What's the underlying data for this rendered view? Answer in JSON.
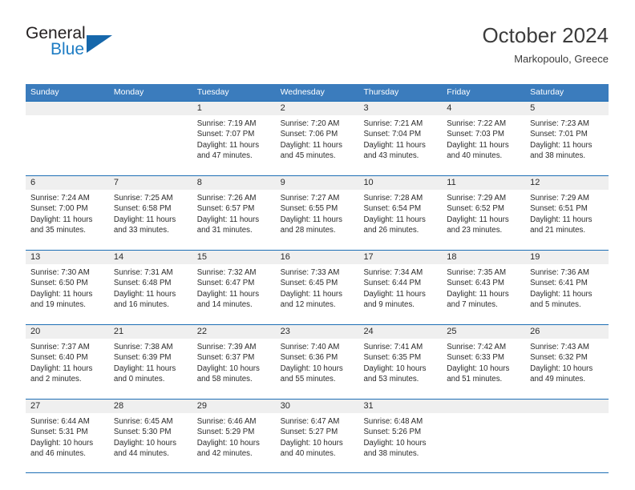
{
  "brand": {
    "name_top": "General",
    "name_bottom": "Blue",
    "triangle_icon": "blue-triangle-icon",
    "color_dark": "#231f20",
    "color_blue": "#1d7cc4"
  },
  "header": {
    "title": "October 2024",
    "subtitle": "Markopoulo, Greece"
  },
  "colors": {
    "header_bar": "#3b7cbd",
    "row_divider": "#1e6fb5",
    "date_band": "#efefef"
  },
  "weekdays": [
    "Sunday",
    "Monday",
    "Tuesday",
    "Wednesday",
    "Thursday",
    "Friday",
    "Saturday"
  ],
  "weeks": [
    [
      {
        "day": "",
        "lines": []
      },
      {
        "day": "",
        "lines": []
      },
      {
        "day": "1",
        "lines": [
          "Sunrise: 7:19 AM",
          "Sunset: 7:07 PM",
          "Daylight: 11 hours",
          "and 47 minutes."
        ]
      },
      {
        "day": "2",
        "lines": [
          "Sunrise: 7:20 AM",
          "Sunset: 7:06 PM",
          "Daylight: 11 hours",
          "and 45 minutes."
        ]
      },
      {
        "day": "3",
        "lines": [
          "Sunrise: 7:21 AM",
          "Sunset: 7:04 PM",
          "Daylight: 11 hours",
          "and 43 minutes."
        ]
      },
      {
        "day": "4",
        "lines": [
          "Sunrise: 7:22 AM",
          "Sunset: 7:03 PM",
          "Daylight: 11 hours",
          "and 40 minutes."
        ]
      },
      {
        "day": "5",
        "lines": [
          "Sunrise: 7:23 AM",
          "Sunset: 7:01 PM",
          "Daylight: 11 hours",
          "and 38 minutes."
        ]
      }
    ],
    [
      {
        "day": "6",
        "lines": [
          "Sunrise: 7:24 AM",
          "Sunset: 7:00 PM",
          "Daylight: 11 hours",
          "and 35 minutes."
        ]
      },
      {
        "day": "7",
        "lines": [
          "Sunrise: 7:25 AM",
          "Sunset: 6:58 PM",
          "Daylight: 11 hours",
          "and 33 minutes."
        ]
      },
      {
        "day": "8",
        "lines": [
          "Sunrise: 7:26 AM",
          "Sunset: 6:57 PM",
          "Daylight: 11 hours",
          "and 31 minutes."
        ]
      },
      {
        "day": "9",
        "lines": [
          "Sunrise: 7:27 AM",
          "Sunset: 6:55 PM",
          "Daylight: 11 hours",
          "and 28 minutes."
        ]
      },
      {
        "day": "10",
        "lines": [
          "Sunrise: 7:28 AM",
          "Sunset: 6:54 PM",
          "Daylight: 11 hours",
          "and 26 minutes."
        ]
      },
      {
        "day": "11",
        "lines": [
          "Sunrise: 7:29 AM",
          "Sunset: 6:52 PM",
          "Daylight: 11 hours",
          "and 23 minutes."
        ]
      },
      {
        "day": "12",
        "lines": [
          "Sunrise: 7:29 AM",
          "Sunset: 6:51 PM",
          "Daylight: 11 hours",
          "and 21 minutes."
        ]
      }
    ],
    [
      {
        "day": "13",
        "lines": [
          "Sunrise: 7:30 AM",
          "Sunset: 6:50 PM",
          "Daylight: 11 hours",
          "and 19 minutes."
        ]
      },
      {
        "day": "14",
        "lines": [
          "Sunrise: 7:31 AM",
          "Sunset: 6:48 PM",
          "Daylight: 11 hours",
          "and 16 minutes."
        ]
      },
      {
        "day": "15",
        "lines": [
          "Sunrise: 7:32 AM",
          "Sunset: 6:47 PM",
          "Daylight: 11 hours",
          "and 14 minutes."
        ]
      },
      {
        "day": "16",
        "lines": [
          "Sunrise: 7:33 AM",
          "Sunset: 6:45 PM",
          "Daylight: 11 hours",
          "and 12 minutes."
        ]
      },
      {
        "day": "17",
        "lines": [
          "Sunrise: 7:34 AM",
          "Sunset: 6:44 PM",
          "Daylight: 11 hours",
          "and 9 minutes."
        ]
      },
      {
        "day": "18",
        "lines": [
          "Sunrise: 7:35 AM",
          "Sunset: 6:43 PM",
          "Daylight: 11 hours",
          "and 7 minutes."
        ]
      },
      {
        "day": "19",
        "lines": [
          "Sunrise: 7:36 AM",
          "Sunset: 6:41 PM",
          "Daylight: 11 hours",
          "and 5 minutes."
        ]
      }
    ],
    [
      {
        "day": "20",
        "lines": [
          "Sunrise: 7:37 AM",
          "Sunset: 6:40 PM",
          "Daylight: 11 hours",
          "and 2 minutes."
        ]
      },
      {
        "day": "21",
        "lines": [
          "Sunrise: 7:38 AM",
          "Sunset: 6:39 PM",
          "Daylight: 11 hours",
          "and 0 minutes."
        ]
      },
      {
        "day": "22",
        "lines": [
          "Sunrise: 7:39 AM",
          "Sunset: 6:37 PM",
          "Daylight: 10 hours",
          "and 58 minutes."
        ]
      },
      {
        "day": "23",
        "lines": [
          "Sunrise: 7:40 AM",
          "Sunset: 6:36 PM",
          "Daylight: 10 hours",
          "and 55 minutes."
        ]
      },
      {
        "day": "24",
        "lines": [
          "Sunrise: 7:41 AM",
          "Sunset: 6:35 PM",
          "Daylight: 10 hours",
          "and 53 minutes."
        ]
      },
      {
        "day": "25",
        "lines": [
          "Sunrise: 7:42 AM",
          "Sunset: 6:33 PM",
          "Daylight: 10 hours",
          "and 51 minutes."
        ]
      },
      {
        "day": "26",
        "lines": [
          "Sunrise: 7:43 AM",
          "Sunset: 6:32 PM",
          "Daylight: 10 hours",
          "and 49 minutes."
        ]
      }
    ],
    [
      {
        "day": "27",
        "lines": [
          "Sunrise: 6:44 AM",
          "Sunset: 5:31 PM",
          "Daylight: 10 hours",
          "and 46 minutes."
        ]
      },
      {
        "day": "28",
        "lines": [
          "Sunrise: 6:45 AM",
          "Sunset: 5:30 PM",
          "Daylight: 10 hours",
          "and 44 minutes."
        ]
      },
      {
        "day": "29",
        "lines": [
          "Sunrise: 6:46 AM",
          "Sunset: 5:29 PM",
          "Daylight: 10 hours",
          "and 42 minutes."
        ]
      },
      {
        "day": "30",
        "lines": [
          "Sunrise: 6:47 AM",
          "Sunset: 5:27 PM",
          "Daylight: 10 hours",
          "and 40 minutes."
        ]
      },
      {
        "day": "31",
        "lines": [
          "Sunrise: 6:48 AM",
          "Sunset: 5:26 PM",
          "Daylight: 10 hours",
          "and 38 minutes."
        ]
      },
      {
        "day": "",
        "lines": []
      },
      {
        "day": "",
        "lines": []
      }
    ]
  ]
}
